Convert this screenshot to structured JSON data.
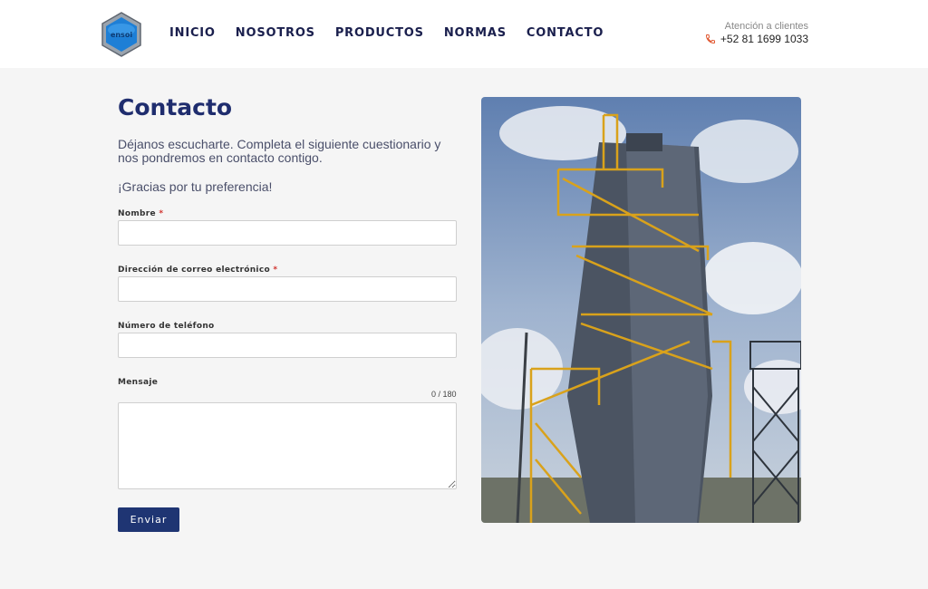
{
  "header": {
    "logo_text": "ensoi",
    "nav": [
      {
        "label": "INICIO"
      },
      {
        "label": "NOSOTROS"
      },
      {
        "label": "PRODUCTOS"
      },
      {
        "label": "NORMAS"
      },
      {
        "label": "CONTACTO"
      }
    ],
    "contact_label": "Atención a clientes",
    "contact_phone": "+52 81 1699 1033",
    "phone_icon": "phone-icon"
  },
  "main": {
    "title": "Contacto",
    "intro": "Déjanos escucharte. Completa el siguiente cuestionario y nos pondremos en contacto contigo.",
    "thanks": "¡Gracias por tu preferencia!",
    "form": {
      "name_label": "Nombre",
      "email_label": "Dirección de correo electrónico",
      "phone_label": "Número de teléfono",
      "message_label": "Mensaje",
      "required_mark": "*",
      "name_value": "",
      "email_value": "",
      "phone_value": "",
      "message_value": "",
      "counter": "0 / 180",
      "submit_label": "Enviar"
    }
  },
  "colors": {
    "brand_navy": "#1f2d6e",
    "button": "#1f3573",
    "required": "#d0312d",
    "phone_icon": "#e0552e",
    "page_bg": "#f5f5f5"
  }
}
